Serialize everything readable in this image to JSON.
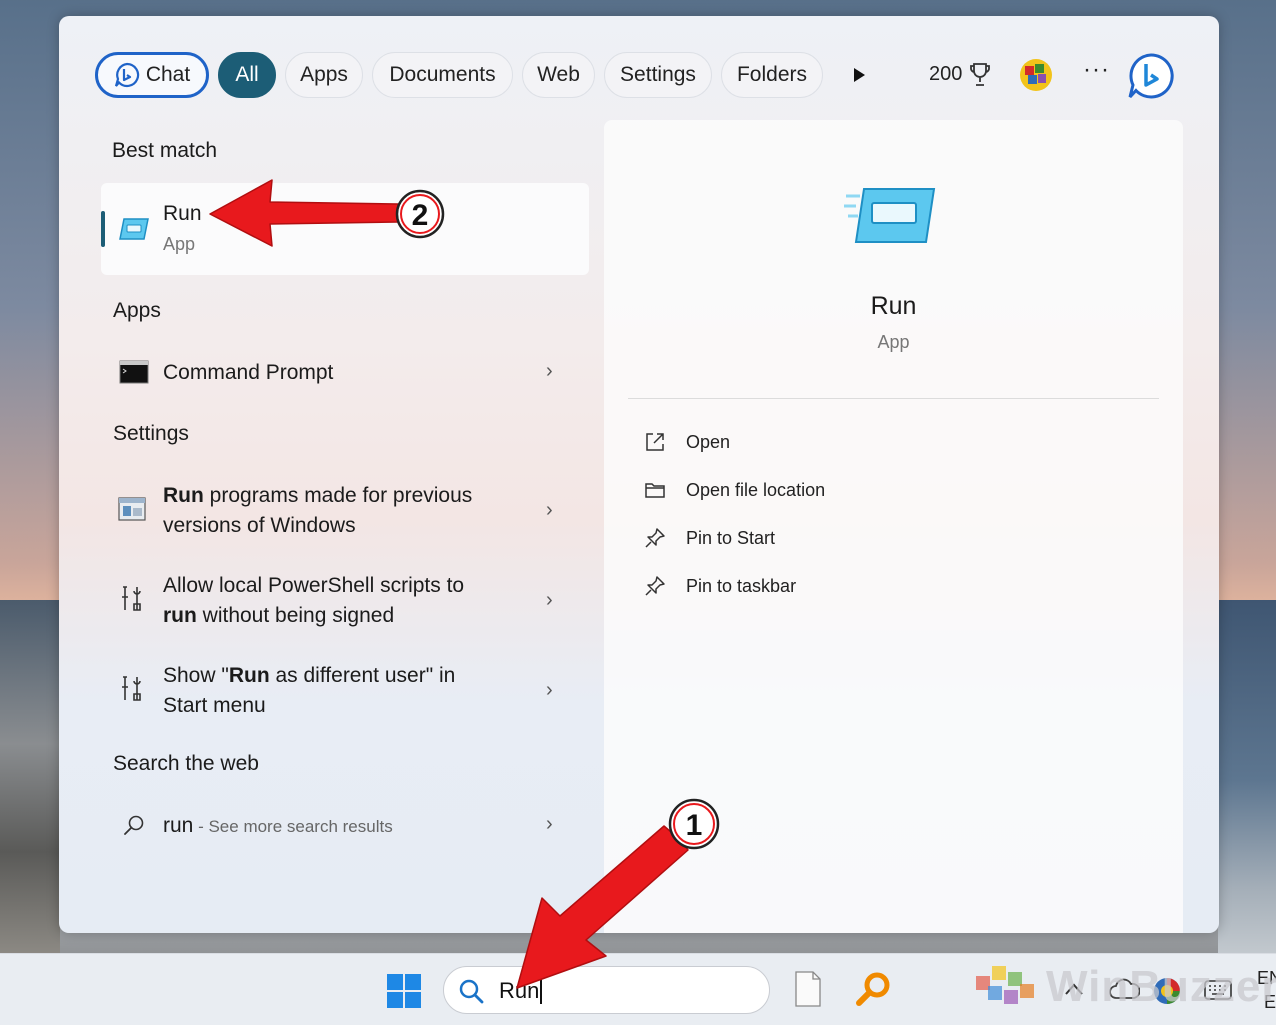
{
  "filters": {
    "chat": "Chat",
    "all": "All",
    "apps": "Apps",
    "documents": "Documents",
    "web": "Web",
    "settings": "Settings",
    "folders": "Folders",
    "points": "200"
  },
  "results": {
    "best_match_title": "Best match",
    "best": {
      "title": "Run",
      "sub": "App"
    },
    "apps_title": "Apps",
    "command_prompt": "Command Prompt",
    "settings_title": "Settings",
    "setting1": {
      "bold": "Run",
      "rest1": " programs made for previous",
      "line2": "versions of Windows"
    },
    "setting2": {
      "line1": "Allow local PowerShell scripts to",
      "bold": "run",
      "rest2": " without being signed"
    },
    "setting3": {
      "pre": "Show \"",
      "bold": "Run",
      "post": " as different user\" in",
      "line2": "Start menu"
    },
    "web_title": "Search the web",
    "web_query": "run",
    "web_more": " - See more search results"
  },
  "preview": {
    "title": "Run",
    "sub": "App",
    "actions": [
      "Open",
      "Open file location",
      "Pin to Start",
      "Pin to taskbar"
    ]
  },
  "taskbar": {
    "search_value": "Run",
    "lang1": "EN",
    "lang2": "E"
  },
  "callouts": {
    "one": "1",
    "two": "2"
  },
  "watermark": "WinBuzzer",
  "colors": {
    "accent": "#1c5d76",
    "chat_border": "#1f63c8",
    "arrow": "#e8191d"
  }
}
